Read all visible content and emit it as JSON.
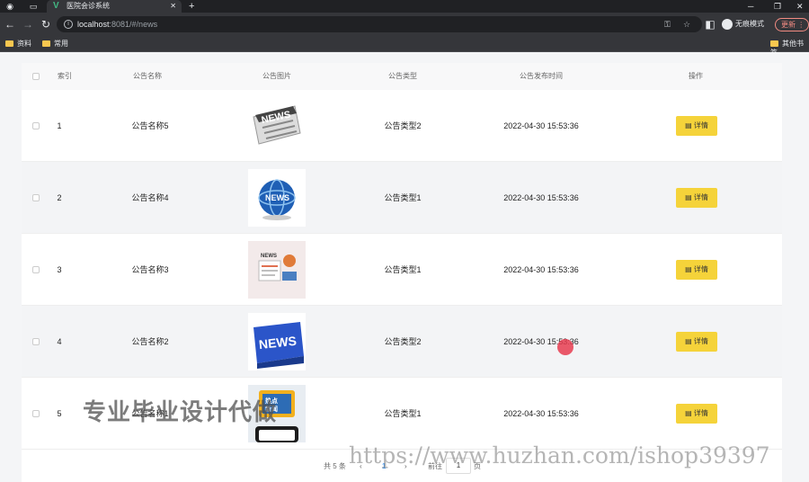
{
  "browser": {
    "tab_title": "医院会诊系统",
    "url_host": "localhost",
    "url_rest": ":8081/#/news",
    "profile_label": "无痕模式",
    "update_label": "更新",
    "bookmarks": [
      "资料",
      "常用"
    ],
    "other_bookmarks": "其他书签"
  },
  "table": {
    "headers": {
      "index": "索引",
      "name": "公告名称",
      "image": "公告图片",
      "type": "公告类型",
      "time": "公告发布时间",
      "action": "操作"
    },
    "detail_label": "详情",
    "rows": [
      {
        "index": "1",
        "name": "公告名称5",
        "type": "公告类型2",
        "time": "2022-04-30 15:53:36",
        "image": "news-newspaper-icon"
      },
      {
        "index": "2",
        "name": "公告名称4",
        "type": "公告类型1",
        "time": "2022-04-30 15:53:36",
        "image": "news-globe-icon"
      },
      {
        "index": "3",
        "name": "公告名称3",
        "type": "公告类型1",
        "time": "2022-04-30 15:53:36",
        "image": "news-illustration-icon"
      },
      {
        "index": "4",
        "name": "公告名称2",
        "type": "公告类型2",
        "time": "2022-04-30 15:53:36",
        "image": "news-key-icon"
      },
      {
        "index": "5",
        "name": "公告名称1",
        "type": "公告类型1",
        "time": "2022-04-30 15:53:36",
        "image": "news-phone-icon"
      }
    ]
  },
  "pagination": {
    "total_label": "共 5 条",
    "current_page": "1",
    "goto_label": "前往",
    "page_input": "1",
    "page_suffix": "页"
  },
  "watermarks": {
    "text1": "专业毕业设计代做",
    "text2": "https://www.huzhan.com/ishop39397"
  },
  "colors": {
    "detail_button": "#f5d33a",
    "browser_dark": "#202124"
  }
}
